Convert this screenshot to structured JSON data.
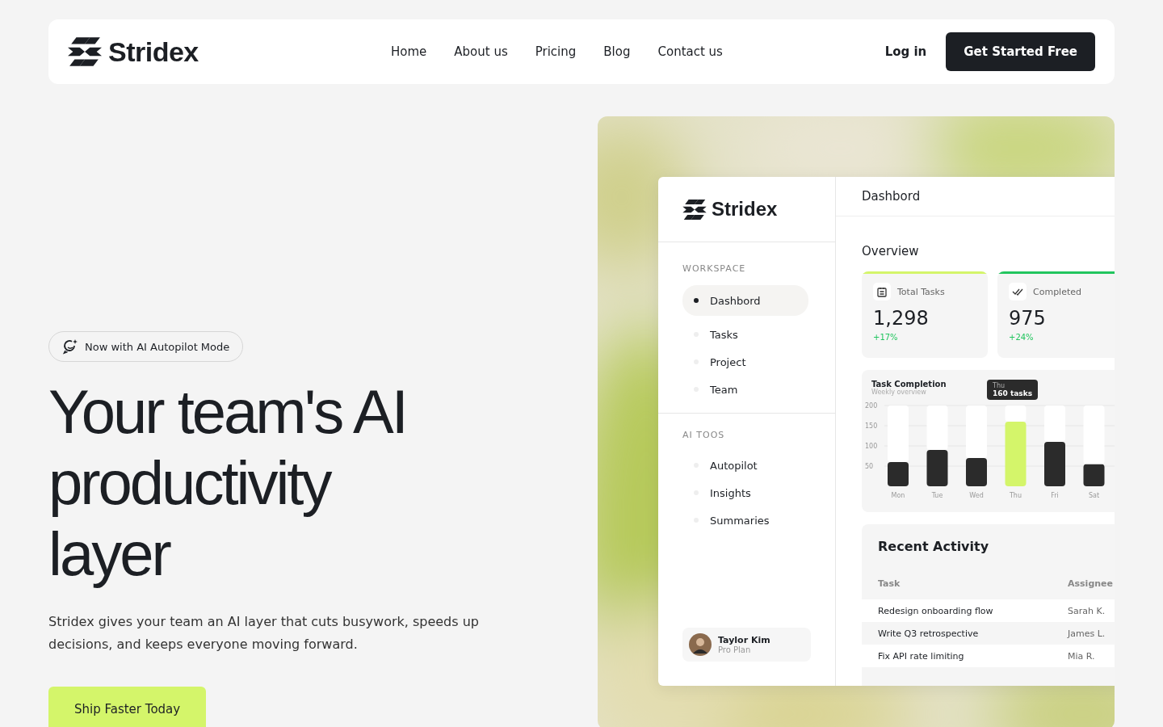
{
  "nav": {
    "brand": "Stridex",
    "links": [
      {
        "label": "Home",
        "selected": false
      },
      {
        "label": "About us",
        "selected": false
      },
      {
        "label": "Pricing",
        "selected": false
      },
      {
        "label": "Blog",
        "selected": false
      },
      {
        "label": "Contact us",
        "selected": false
      }
    ],
    "login": "Log in",
    "cta": "Get Started Free"
  },
  "hero": {
    "badge": "Now with AI Autopilot Mode",
    "heading": "Your team's AI productivity layer",
    "text": "Stridex gives your team an AI layer that cuts busywork, speeds up decisions, and keeps everyone moving forward.",
    "button": "Ship Faster Today"
  },
  "dashboard": {
    "brand": "Stridex",
    "title": "Dashbord",
    "sections": [
      {
        "heading": "WORKSPACE",
        "items": [
          {
            "label": "Dashbord",
            "selected": true
          },
          {
            "label": "Tasks",
            "selected": false
          },
          {
            "label": "Project",
            "selected": false
          },
          {
            "label": "Team",
            "selected": false
          }
        ]
      },
      {
        "heading": "AI TOOS",
        "items": [
          {
            "label": "Autopilot",
            "selected": false
          },
          {
            "label": "Insights",
            "selected": false
          },
          {
            "label": "Summaries",
            "selected": false
          }
        ]
      }
    ],
    "user": {
      "name": "Taylor Kim",
      "plan": "Pro Plan"
    },
    "overview": "Overview",
    "stats": [
      {
        "kind": "tasks",
        "label": "Total Tasks",
        "value": "1,298",
        "change": "+17%",
        "color": "#d4f56a"
      },
      {
        "kind": "done",
        "label": "Completed",
        "value": "975",
        "change": "+24%",
        "color": "#22c55e"
      }
    ],
    "chart": {
      "title": "Task Completion",
      "subtitle": "Weekly overview",
      "tooltip": {
        "label": "Thu",
        "value": "160 tasks"
      },
      "chart_data": {
        "type": "bar",
        "categories": [
          "Mon",
          "Tue",
          "Wed",
          "Thu",
          "Fri",
          "Sat"
        ],
        "series": [
          {
            "color": "#2b2b2b",
            "values": [
              60,
              90,
              70,
              null,
              110,
              55
            ]
          },
          {
            "color": "#d4f56a",
            "values": [
              null,
              null,
              null,
              160,
              null,
              null
            ]
          },
          {
            "color": "#ffffff",
            "values": [
              140,
              110,
              130,
              40,
              90,
              145
            ]
          }
        ],
        "stacked": true,
        "ylim": [
          0,
          200
        ],
        "yticks": [
          50,
          100,
          150,
          200
        ],
        "grid": true
      }
    },
    "activity": {
      "title": "Recent Activity",
      "columns": [
        "Task",
        "Assignee"
      ],
      "rows": [
        [
          "Redesign onboarding flow",
          "Sarah K."
        ],
        [
          "Write Q3 retrospective",
          "James L."
        ],
        [
          "Fix API rate limiting",
          "Mia R."
        ]
      ]
    }
  }
}
